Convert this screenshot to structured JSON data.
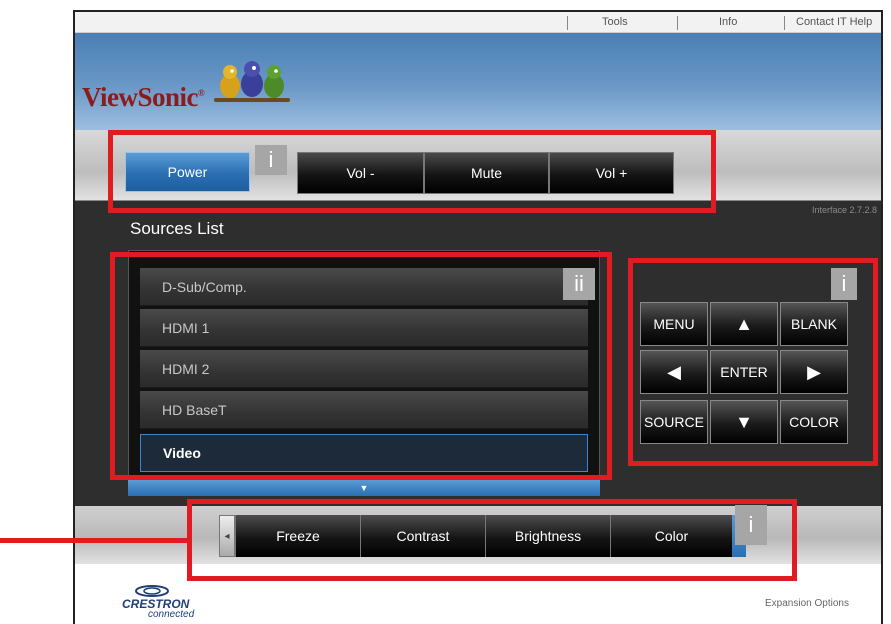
{
  "topnav": {
    "tools": "Tools",
    "info": "Info",
    "contact": "Contact IT Help"
  },
  "brand": {
    "logo_text": "ViewSonic",
    "registered": "®"
  },
  "power_bar": {
    "power": "Power",
    "vol_down": "Vol -",
    "mute": "Mute",
    "vol_up": "Vol +",
    "marker": "i"
  },
  "interface_version": "Interface 2.7.2.8",
  "sources": {
    "title": "Sources List",
    "items": [
      "D-Sub/Comp.",
      "HDMI 1",
      "HDMI 2",
      "HD BaseT",
      "Video"
    ],
    "selected": "Video",
    "marker": "ii",
    "scroll_down_glyph": "▼"
  },
  "remote": {
    "menu": "MENU",
    "up": "▲",
    "blank": "BLANK",
    "left": "◀",
    "enter": "ENTER",
    "right": "▶",
    "source": "SOURCE",
    "down": "▼",
    "color": "COLOR",
    "marker": "i"
  },
  "features": {
    "items": [
      "Freeze",
      "Contrast",
      "Brightness",
      "Color"
    ],
    "scroll_left_glyph": "◂",
    "marker": "i"
  },
  "footer": {
    "crestron_brand": "CRESTRON",
    "crestron_sub": "connected",
    "expansion": "Expansion Options"
  },
  "colors": {
    "annotation_red": "#e11b22",
    "selected_blue": "#2a6fb3",
    "brand_red": "#8b1c1c"
  }
}
